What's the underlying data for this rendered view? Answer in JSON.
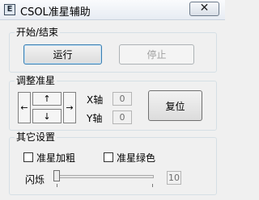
{
  "window": {
    "title": "CSOL准星辅助",
    "icon": "app-e-icon",
    "icon_letter": "E",
    "close_glyph": "✕"
  },
  "start_stop": {
    "legend": "开始/结束",
    "run_label": "运行",
    "stop_label": "停止"
  },
  "adjust": {
    "legend": "调整准星",
    "up_arrow": "↑",
    "down_arrow": "↓",
    "left_arrow": "←",
    "right_arrow": "→",
    "x_label": "X轴",
    "x_value": "0",
    "y_label": "Y轴",
    "y_value": "0",
    "reset_label": "复位"
  },
  "other": {
    "legend": "其它设置",
    "bold_crosshair_label": "准星加粗",
    "bold_crosshair_checked": false,
    "green_crosshair_label": "准星绿色",
    "green_crosshair_checked": false,
    "flicker_label": "闪烁",
    "flicker_value": "10",
    "flicker_level_fraction": 0.0
  }
}
